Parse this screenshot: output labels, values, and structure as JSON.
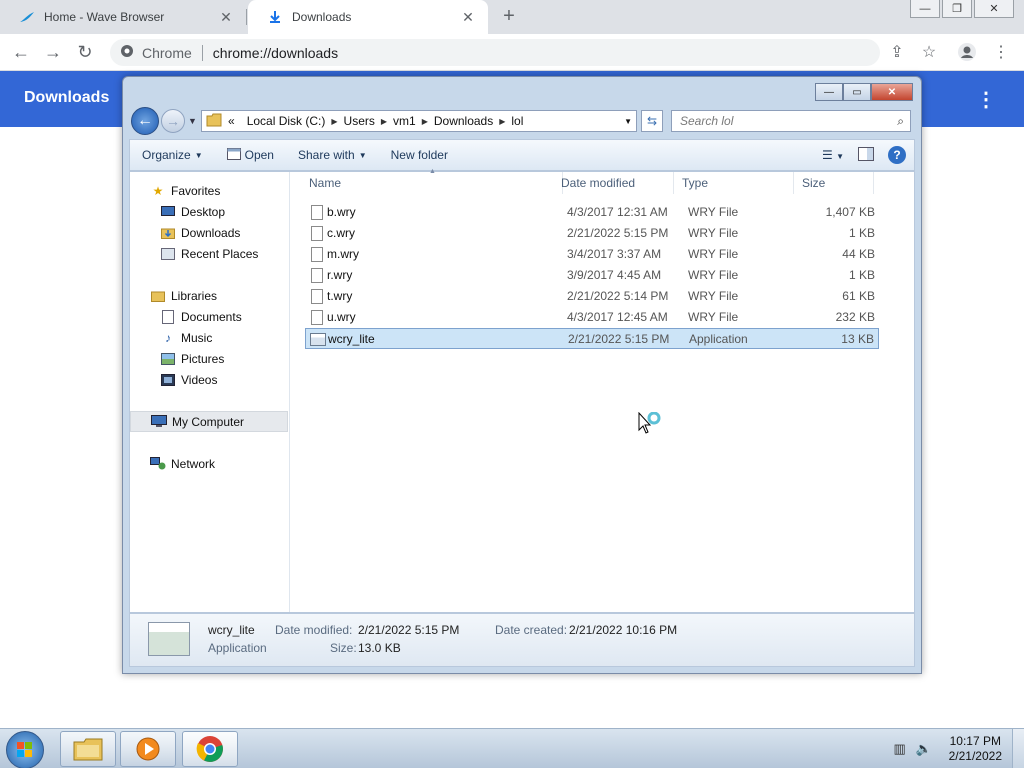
{
  "browser": {
    "tabs": [
      {
        "title": "Home - Wave Browser",
        "close": "✕"
      },
      {
        "title": "Downloads",
        "close": "✕"
      }
    ],
    "new_tab": "+",
    "window_controls": {
      "minimize": "—",
      "maximize": "❐",
      "close": "✕"
    },
    "omnibox": {
      "chip": "Chrome",
      "url": "chrome://downloads"
    }
  },
  "downloads_page": {
    "title": "Downloads",
    "menu": "⋮"
  },
  "explorer": {
    "caption": {
      "minimize": "—",
      "maximize": "▭",
      "close": "✕"
    },
    "address": {
      "prefix": "«",
      "crumbs": [
        "Local Disk (C:)",
        "Users",
        "vm1",
        "Downloads",
        "lol"
      ]
    },
    "search_placeholder": "Search lol",
    "commands": {
      "organize": "Organize",
      "open": "Open",
      "share_with": "Share with",
      "new_folder": "New folder"
    },
    "nav": {
      "favorites": "Favorites",
      "desktop": "Desktop",
      "downloads": "Downloads",
      "recent_places": "Recent Places",
      "libraries": "Libraries",
      "documents": "Documents",
      "music": "Music",
      "pictures": "Pictures",
      "videos": "Videos",
      "my_computer": "My Computer",
      "network": "Network"
    },
    "columns": {
      "name": "Name",
      "date_modified": "Date modified",
      "type": "Type",
      "size": "Size"
    },
    "files": [
      {
        "name": "b.wry",
        "date": "4/3/2017 12:31 AM",
        "type": "WRY File",
        "size": "1,407 KB"
      },
      {
        "name": "c.wry",
        "date": "2/21/2022 5:15 PM",
        "type": "WRY File",
        "size": "1 KB"
      },
      {
        "name": "m.wry",
        "date": "3/4/2017 3:37 AM",
        "type": "WRY File",
        "size": "44 KB"
      },
      {
        "name": "r.wry",
        "date": "3/9/2017 4:45 AM",
        "type": "WRY File",
        "size": "1 KB"
      },
      {
        "name": "t.wry",
        "date": "2/21/2022 5:14 PM",
        "type": "WRY File",
        "size": "61 KB"
      },
      {
        "name": "u.wry",
        "date": "4/3/2017 12:45 AM",
        "type": "WRY File",
        "size": "232 KB"
      },
      {
        "name": "wcry_lite",
        "date": "2/21/2022 5:15 PM",
        "type": "Application",
        "size": "13 KB"
      }
    ],
    "details": {
      "name": "wcry_lite",
      "type": "Application",
      "date_modified_label": "Date modified:",
      "date_modified": "2/21/2022 5:15 PM",
      "size_label": "Size:",
      "size": "13.0 KB",
      "date_created_label": "Date created:",
      "date_created": "2/21/2022 10:16 PM"
    }
  },
  "taskbar": {
    "clock_time": "10:17 PM",
    "clock_date": "2/21/2022"
  }
}
